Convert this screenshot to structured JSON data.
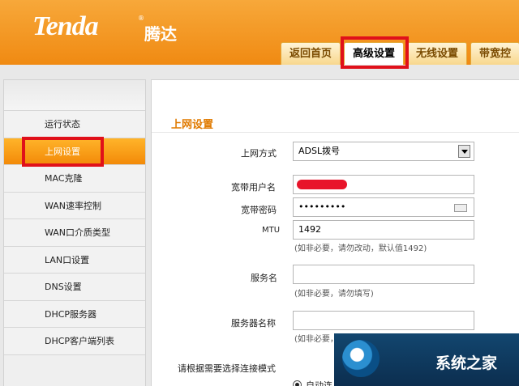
{
  "brand": {
    "logo_text": "Tenda",
    "reg_mark": "®",
    "cn_name": "腾达"
  },
  "tabs": [
    {
      "label": "返回首页"
    },
    {
      "label": "高级设置"
    },
    {
      "label": "无线设置"
    },
    {
      "label": "带宽控"
    }
  ],
  "sidebar": {
    "items": [
      {
        "label": "运行状态"
      },
      {
        "label": "上网设置"
      },
      {
        "label": "MAC克隆"
      },
      {
        "label": "WAN速率控制"
      },
      {
        "label": "WAN口介质类型"
      },
      {
        "label": "LAN口设置"
      },
      {
        "label": "DNS设置"
      },
      {
        "label": "DHCP服务器"
      },
      {
        "label": "DHCP客户端列表"
      }
    ]
  },
  "main": {
    "section_title": "上网设置",
    "connection_type": {
      "label": "上网方式",
      "value": "ADSL拨号"
    },
    "username": {
      "label": "宽带用户名",
      "value": ""
    },
    "password": {
      "label": "宽带密码",
      "value": "•••••••••"
    },
    "mtu": {
      "label": "MTU",
      "value": "1492",
      "hint": "(如非必要，请勿改动，默认值1492)"
    },
    "service_name": {
      "label": "服务名",
      "value": "",
      "hint": "(如非必要，请勿填写)"
    },
    "server_name": {
      "label": "服务器名称",
      "value": "",
      "hint": "(如非必要，请勿填写)"
    },
    "connect_mode": {
      "label": "请根据需要选择连接模式",
      "option_auto": "自动连"
    }
  },
  "watermark": {
    "text": "系统之家"
  },
  "colors": {
    "brand_orange": "#f08a12",
    "highlight_red": "#e0101a",
    "title_orange": "#e07a00"
  }
}
